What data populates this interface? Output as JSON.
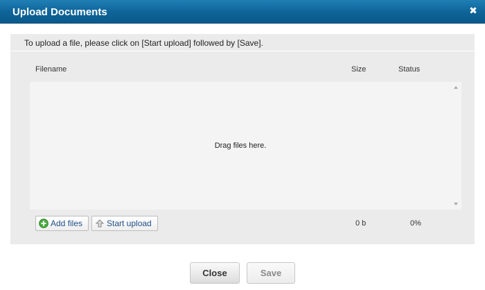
{
  "dialog": {
    "title": "Upload Documents",
    "close_icon": "close-x-icon"
  },
  "instructions": "To upload a file, please click on [Start upload] followed by [Save].",
  "file_table": {
    "headers": {
      "filename": "Filename",
      "size": "Size",
      "status": "Status"
    },
    "empty_message": "Drag files here."
  },
  "toolbar": {
    "add_files": {
      "label": "Add files",
      "icon": "plus-circle-icon"
    },
    "start_upload": {
      "label": "Start upload",
      "icon": "upload-arrow-icon"
    },
    "total_size": "0 b",
    "total_status": "0%"
  },
  "actions": {
    "close_label": "Close",
    "save_label": "Save"
  },
  "colors": {
    "titlebar": "#0e6397",
    "panel": "#ebebeb",
    "link_text": "#1f4e8a"
  }
}
